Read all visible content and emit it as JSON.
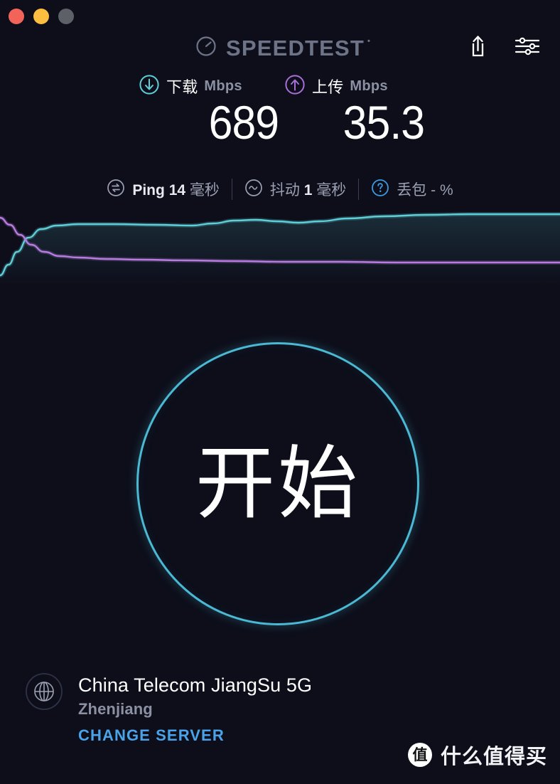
{
  "window": {
    "traffic_lights": [
      {
        "name": "close",
        "color": "#f2645a"
      },
      {
        "name": "minimize",
        "color": "#fcbe40"
      },
      {
        "name": "maximize",
        "color": "#5d6066"
      }
    ]
  },
  "header": {
    "logo_text": "SPEEDTEST",
    "logo_trademark": "•",
    "logo_icon": "speed-gauge-icon",
    "share_icon": "share-icon",
    "settings_icon": "settings-sliders-icon",
    "logo_color": "#6e7488"
  },
  "results": {
    "download": {
      "icon": "arrow-down-circle-icon",
      "label": "下载",
      "unit": "Mbps",
      "value": "689",
      "color": "#5ecfd6"
    },
    "upload": {
      "icon": "arrow-up-circle-icon",
      "label": "上传",
      "unit": "Mbps",
      "value": "35.3",
      "color": "#a66fd6"
    }
  },
  "ping_row": {
    "ping": {
      "icon": "ping-exchange-icon",
      "label": "Ping",
      "value": "14",
      "unit": "毫秒"
    },
    "jitter": {
      "icon": "jitter-wave-icon",
      "label": "抖动",
      "value": "1",
      "unit": "毫秒"
    },
    "loss": {
      "icon": "help-question-icon",
      "label": "丢包",
      "value": "-",
      "unit": "%",
      "icon_color": "#3d9ae0"
    }
  },
  "chart_data": {
    "type": "line",
    "title": "",
    "xlabel": "",
    "ylabel": "",
    "grid": false,
    "legend": "none",
    "xlim": [
      0,
      788
    ],
    "ylim": [
      0,
      110
    ],
    "series": [
      {
        "name": "下载",
        "color": "#5ecfd6",
        "points": [
          [
            0,
            95
          ],
          [
            12,
            80
          ],
          [
            24,
            62
          ],
          [
            40,
            42
          ],
          [
            58,
            30
          ],
          [
            80,
            25
          ],
          [
            110,
            23
          ],
          [
            160,
            23
          ],
          [
            220,
            24
          ],
          [
            270,
            25
          ],
          [
            300,
            22
          ],
          [
            330,
            18
          ],
          [
            360,
            17
          ],
          [
            390,
            19
          ],
          [
            420,
            21
          ],
          [
            450,
            19
          ],
          [
            490,
            15
          ],
          [
            540,
            12
          ],
          [
            600,
            10
          ],
          [
            660,
            9
          ],
          [
            720,
            9
          ],
          [
            788,
            9
          ]
        ]
      },
      {
        "name": "上传",
        "color": "#b87ce0",
        "points": [
          [
            0,
            14
          ],
          [
            14,
            24
          ],
          [
            28,
            38
          ],
          [
            44,
            52
          ],
          [
            62,
            62
          ],
          [
            84,
            68
          ],
          [
            110,
            70
          ],
          [
            150,
            72
          ],
          [
            200,
            73
          ],
          [
            260,
            74
          ],
          [
            330,
            75
          ],
          [
            400,
            76
          ],
          [
            480,
            76
          ],
          [
            560,
            77
          ],
          [
            640,
            77
          ],
          [
            720,
            77
          ],
          [
            788,
            77
          ]
        ]
      }
    ]
  },
  "go_button": {
    "label": "开始",
    "color": "#4bb8d4"
  },
  "server": {
    "icon": "globe-icon",
    "name": "China Telecom JiangSu 5G",
    "city": "Zhenjiang",
    "change_label": "CHANGE SERVER",
    "change_color": "#4aa3e8"
  },
  "watermark": {
    "badge": "值",
    "text": "什么值得买"
  }
}
